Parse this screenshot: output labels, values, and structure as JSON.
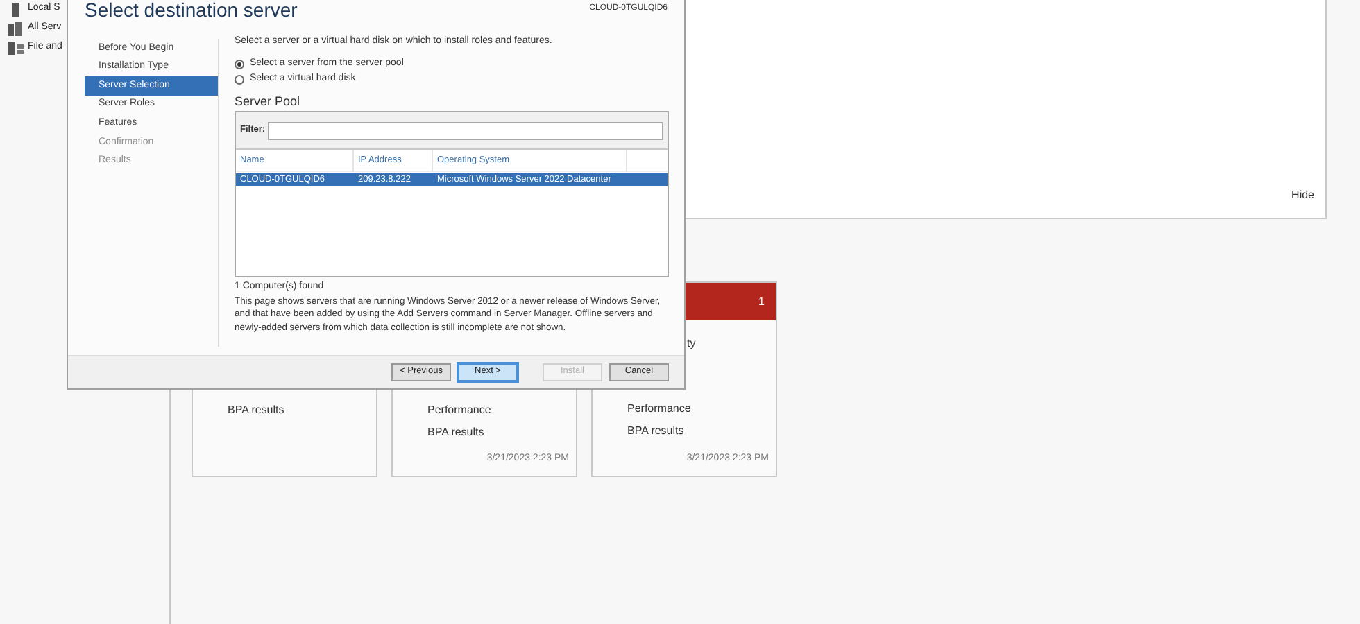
{
  "sidebar": {
    "items": [
      {
        "kind": "server",
        "label": "Local S"
      },
      {
        "kind": "servers",
        "label": "All Serv"
      },
      {
        "kind": "files",
        "label": "File and"
      }
    ]
  },
  "welcome_panel": {
    "hide_link": "Hide"
  },
  "tiles": [
    {
      "alert": false,
      "lines": [
        "BPA results"
      ]
    },
    {
      "alert": false,
      "lines": [
        "Performance",
        "BPA results"
      ],
      "timestamp": "3/21/2023 2:23 PM"
    },
    {
      "alert": true,
      "count": "1",
      "lines": [
        "ty",
        "Performance",
        "BPA results"
      ],
      "timestamp": "3/21/2023 2:23 PM"
    }
  ],
  "dialog": {
    "title": "Select destination server",
    "destination": "CLOUD-0TGULQID6",
    "steps": [
      {
        "label": "Before You Begin",
        "selected": false,
        "disabled": false
      },
      {
        "label": "Installation Type",
        "selected": false,
        "disabled": false
      },
      {
        "label": "Server Selection",
        "selected": true,
        "disabled": false
      },
      {
        "label": "Server Roles",
        "selected": false,
        "disabled": false
      },
      {
        "label": "Features",
        "selected": false,
        "disabled": false
      },
      {
        "label": "Confirmation",
        "selected": false,
        "disabled": true
      },
      {
        "label": "Results",
        "selected": false,
        "disabled": true
      }
    ],
    "instruction": "Select a server or a virtual hard disk on which to install roles and features.",
    "options": [
      {
        "label": "Select a server from the server pool",
        "selected": true
      },
      {
        "label": "Select a virtual hard disk",
        "selected": false
      }
    ],
    "pool": {
      "title": "Server Pool",
      "filter_label": "Filter:",
      "columns": [
        "Name",
        "IP Address",
        "Operating System"
      ],
      "rows": [
        {
          "cells": [
            "CLOUD-0TGULQID6",
            "209.23.8.222",
            "Microsoft Windows Server 2022 Datacenter"
          ],
          "selected": true
        }
      ]
    },
    "count": "1 Computer(s) found",
    "note": "This page shows servers that are running Windows Server 2012 or a newer release of Windows Server, and that have been added by using the Add Servers command in Server Manager. Offline servers and newly-added servers from which data collection is still incomplete are not shown.",
    "buttons": [
      {
        "label": "< Previous",
        "disabled": false,
        "focused": false
      },
      {
        "label": "Next >",
        "disabled": false,
        "focused": true
      },
      {
        "label": "Install",
        "disabled": true,
        "focused": false
      },
      {
        "label": "Cancel",
        "disabled": false,
        "focused": false
      }
    ]
  }
}
